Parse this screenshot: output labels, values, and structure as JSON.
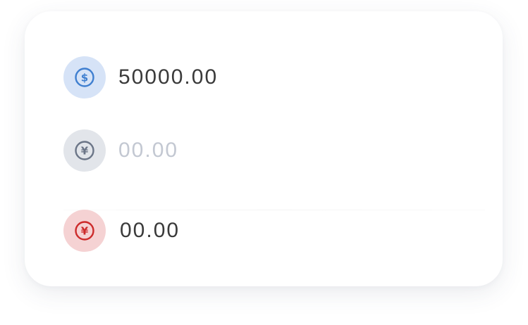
{
  "rows": [
    {
      "icon": "dollar-icon",
      "amount": "50000.00",
      "colors": {
        "circle": "#d6e3f7",
        "glyph": "#3f7fd0",
        "text": "#3a3a3a"
      }
    },
    {
      "icon": "yuan-icon",
      "amount": "00.00",
      "colors": {
        "circle": "#e2e5ea",
        "glyph": "#6b7587",
        "text": "#c3c8d2"
      }
    },
    {
      "icon": "yuan-icon",
      "amount": "00.00",
      "colors": {
        "circle": "#f5d2d3",
        "glyph": "#cc2b2b",
        "text": "#3a3a3a"
      }
    }
  ]
}
